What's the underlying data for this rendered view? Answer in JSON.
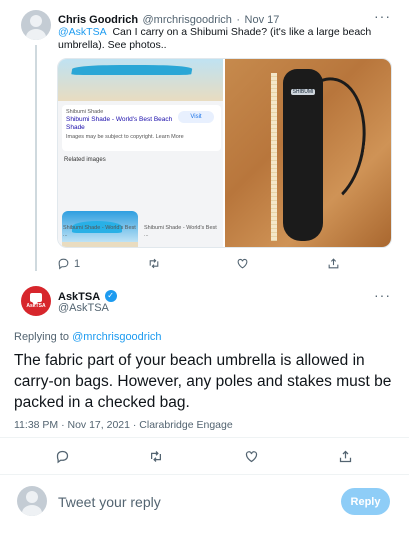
{
  "tweet": {
    "author_name": "Chris Goodrich",
    "handle": "@mrchrisgoodrich",
    "separator": "·",
    "date": "Nov 17",
    "more": "···",
    "mention": "@AskTSA",
    "text": "Can I carry on a Shibumi Shade? (it's like a large beach umbrella). See photos..",
    "media": {
      "site_name": "Shibumi Shade",
      "page_title": "Shibumi Shade - World's Best Beach Shade",
      "visit_label": "Visit",
      "copyright_note": "Images may be subject to copyright. Learn More",
      "related_label": "Related images",
      "thumb1_caption": "Shibumi Shade - World's Best ...",
      "thumb2_caption": "Shibumi Shade - World's Best ...",
      "bag_label": "SHIBUMI"
    },
    "actions": {
      "reply_count": "1"
    }
  },
  "reply": {
    "author_name": "AskTSA",
    "handle": "@AskTSA",
    "avatar_text": "AskTSA",
    "more": "···",
    "replying_prefix": "Replying to",
    "replying_to": "@mrchrisgoodrich",
    "text": "The fabric part of your beach umbrella is allowed in carry-on bags. However, any poles and stakes must be packed in a checked bag.",
    "timestamp": "11:38 PM · Nov 17, 2021 · Clarabridge Engage"
  },
  "composer": {
    "placeholder": "Tweet your reply",
    "button_label": "Reply"
  },
  "colors": {
    "accent": "#1d9bf0",
    "tsa_red": "#d7262c",
    "reply_button": "#8ecdf7"
  }
}
